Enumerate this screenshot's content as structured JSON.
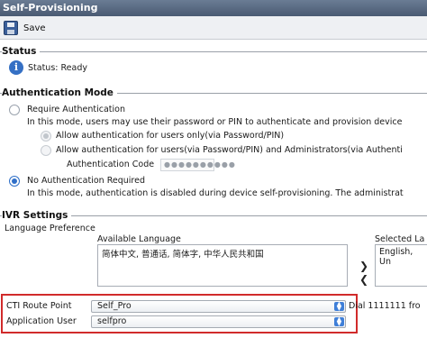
{
  "window": {
    "title": "Self-Provisioning"
  },
  "toolbar": {
    "save_label": "Save",
    "save_icon": "floppy-disk-icon"
  },
  "status": {
    "section_title": "Status",
    "text": "Status: Ready",
    "icon": "info-icon"
  },
  "auth": {
    "section_title": "Authentication Mode",
    "require": {
      "label": "Require Authentication",
      "description": "In this mode, users may use their password or PIN to authenticate and provision device"
    },
    "allow_users_only": "Allow authentication for users only(via Password/PIN)",
    "allow_users_admins": "Allow authentication for users(via Password/PIN) and Administrators(via Authenti",
    "code_label": "Authentication Code",
    "code_value": "●●●●●●●●●●",
    "no_auth": {
      "label": "No Authentication Required",
      "description": "In this mode, authentication is disabled during device self-provisioning. The administrat"
    }
  },
  "ivr": {
    "section_title": "IVR Settings",
    "language_pref_label": "Language Preference",
    "available_label": "Available Language",
    "available_items": [
      "简体中文, 普通话, 简体字, 中华人民共和国"
    ],
    "selected_label": "Selected La",
    "selected_items": [
      "English, Un"
    ],
    "move_right_icon": "arrow-right-icon",
    "move_left_icon": "arrow-left-icon",
    "cti_label": "CTI Route Point",
    "cti_value": "Self_Pro",
    "dial_text": "Dial 1111111 fro",
    "app_user_label": "Application User",
    "app_user_value": "selfpro"
  }
}
